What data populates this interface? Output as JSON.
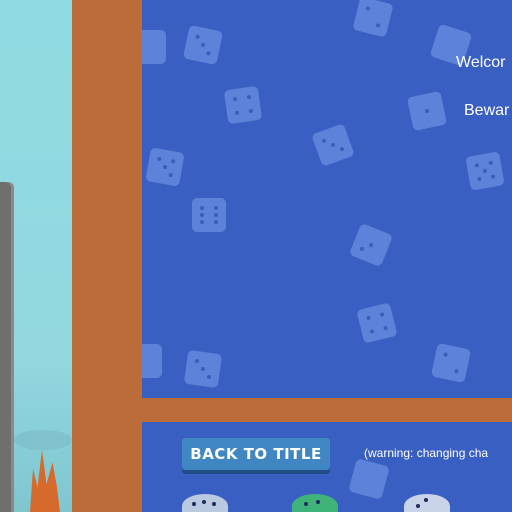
{
  "panel": {
    "welcome_text": "Welcor",
    "beware_text": "Bewar"
  },
  "controls": {
    "back_to_title_label": "BACK TO TITLE",
    "warning_text": "(warning: changing cha"
  },
  "colors": {
    "panel_blue": "#3a5fc3",
    "frame_wood": "#bc6c38",
    "button_blue": "#3f86c2",
    "sky": "#8fd6de"
  },
  "icons": [
    "die-icon",
    "dice-choice-icon"
  ]
}
